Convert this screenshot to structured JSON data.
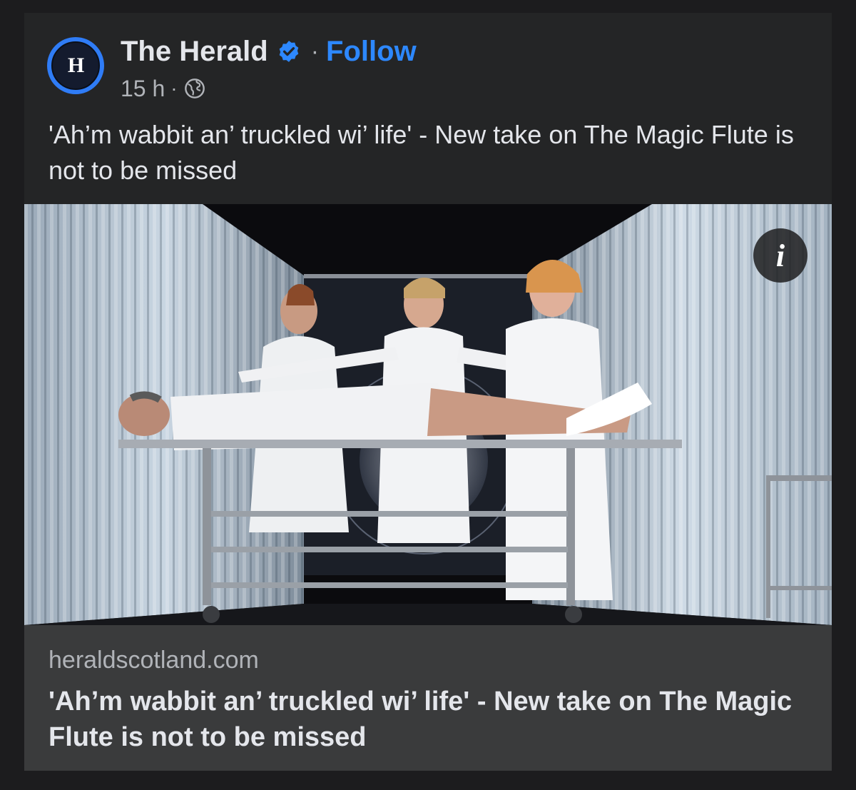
{
  "post": {
    "page_name": "The Herald",
    "avatar_text": "H",
    "separator": "·",
    "follow_label": "Follow",
    "time": "15 h",
    "audience_icon": "globe-icon",
    "verified_icon": "verified-badge-icon",
    "caption": "'Ah’m wabbit an’ truckled wi’ life' - New take on The Magic Flute is not to be missed"
  },
  "image": {
    "info_label": "i"
  },
  "link_preview": {
    "domain": "heraldscotland.com",
    "title": "'Ah’m wabbit an’ truckled wi’ life' - New take on The Magic Flute is not to be missed"
  },
  "colors": {
    "background": "#1c1c1e",
    "card": "#242526",
    "link_box": "#3a3b3c",
    "accent": "#2d88ff",
    "text_primary": "#e4e6eb",
    "text_secondary": "#b0b3b8"
  }
}
